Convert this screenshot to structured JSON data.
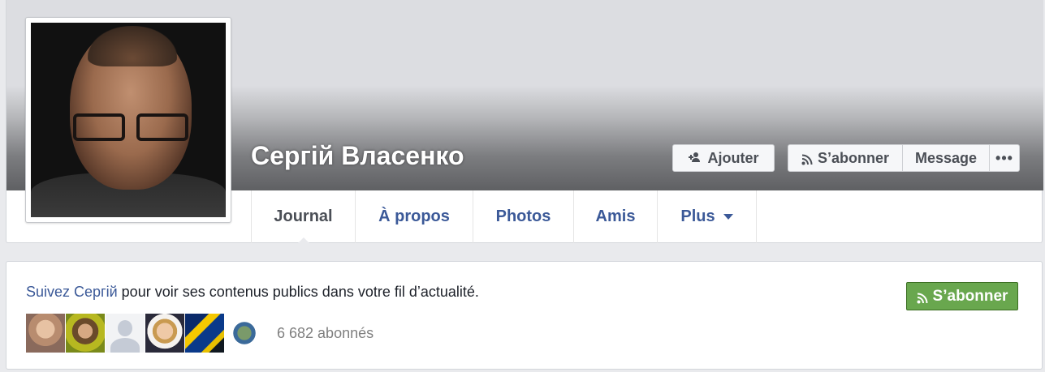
{
  "profile": {
    "name": "Сергій Власенко"
  },
  "actions": {
    "add_friend_label": "Ajouter",
    "subscribe_label": "S’abonner",
    "message_label": "Message",
    "more_label": "•••"
  },
  "tabs": [
    {
      "label": "Journal",
      "active": true
    },
    {
      "label": "À propos",
      "active": false
    },
    {
      "label": "Photos",
      "active": false
    },
    {
      "label": "Amis",
      "active": false
    },
    {
      "label": "Plus",
      "active": false
    }
  ],
  "follow": {
    "link_text": "Suivez Сергій",
    "rest_text": " pour voir ses contenus publics dans votre fil d’actualité.",
    "subscribe_button": "S’abonner",
    "followers_count": "6 682 abonnés"
  },
  "colors": {
    "link": "#3b5998",
    "green_button": "#69a74e"
  },
  "icons": {
    "add_friend": "add-friend-icon",
    "subscribe": "rss-icon",
    "more": "more-dots-icon",
    "plus_caret": "caret-down-icon"
  }
}
